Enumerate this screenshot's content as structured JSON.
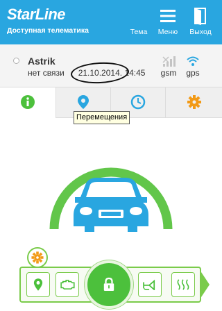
{
  "header": {
    "logo": "StarLine",
    "subtitle": "Доступная телематика",
    "theme_label": "Тема",
    "menu_label": "Меню",
    "exit_label": "Выход",
    "background_color": "#29a6e0"
  },
  "vehicle": {
    "name": "Astrik",
    "connection_status": "нет связи",
    "last_date": "21.10.2014.",
    "last_time": "14:45",
    "gsm_label": "gsm",
    "gps_label": "gps"
  },
  "tabs": [
    {
      "name": "info",
      "icon": "info-icon",
      "active": true
    },
    {
      "name": "movements",
      "icon": "location-pin-icon",
      "active": false
    },
    {
      "name": "history",
      "icon": "clock-icon",
      "active": false
    },
    {
      "name": "settings",
      "icon": "gear-icon",
      "active": false
    }
  ],
  "tooltip": "Перемещения",
  "controls": {
    "items": [
      {
        "name": "map",
        "icon": "map-pin-icon"
      },
      {
        "name": "engine",
        "icon": "engine-icon"
      },
      {
        "name": "lock",
        "icon": "lock-icon"
      },
      {
        "name": "horn",
        "icon": "horn-icon"
      },
      {
        "name": "heater",
        "icon": "heater-icon"
      }
    ],
    "accent_color": "#4cc03c"
  }
}
